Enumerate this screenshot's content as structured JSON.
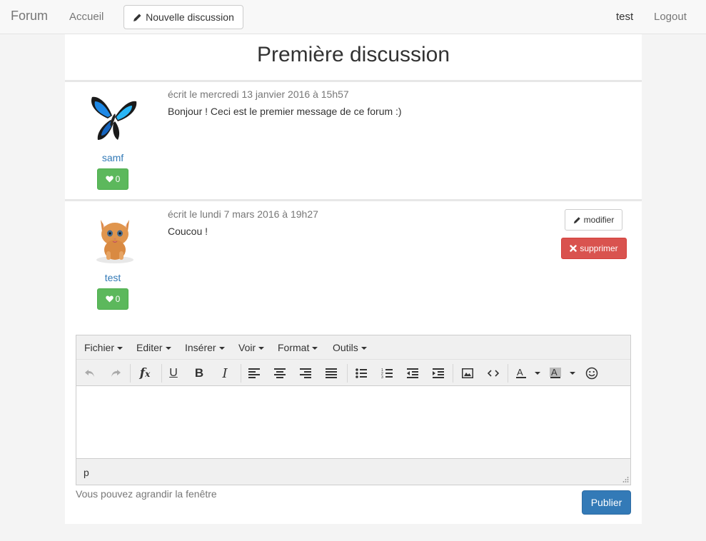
{
  "navbar": {
    "brand": "Forum",
    "home": "Accueil",
    "new_discussion": "Nouvelle discussion",
    "user": "test",
    "logout": "Logout"
  },
  "topic": {
    "title": "Première discussion"
  },
  "posts": [
    {
      "author": "samf",
      "avatar": "butterfly-avatar",
      "likes": "0",
      "meta": "écrit le mercredi 13 janvier 2016 à 15h57",
      "message": "Bonjour ! Ceci est le premier message de ce forum :)"
    },
    {
      "author": "test",
      "avatar": "kitten-avatar",
      "likes": "0",
      "meta": "écrit le lundi 7 mars 2016 à 19h27",
      "message": "Coucou !",
      "edit_label": "modifier",
      "delete_label": "supprimer"
    }
  ],
  "editor": {
    "menus": [
      "Fichier",
      "Editer",
      "Insérer",
      "Voir",
      "Format",
      "Outils"
    ],
    "toolbar_icons": [
      "undo-icon",
      "redo-icon",
      "clear-format-icon",
      "underline-icon",
      "bold-icon",
      "italic-icon",
      "align-left-icon",
      "align-center-icon",
      "align-right-icon",
      "align-justify-icon",
      "bullet-list-icon",
      "numbered-list-icon",
      "outdent-icon",
      "indent-icon",
      "image-icon",
      "code-icon",
      "text-color-icon",
      "background-color-icon",
      "emoticon-icon"
    ],
    "path": "p",
    "hint": "Vous pouvez agrandir la fenêtre",
    "publish": "Publier"
  },
  "colors": {
    "link": "#337ab7",
    "success": "#5cb85c",
    "danger": "#d9534f",
    "primary": "#337ab7"
  }
}
